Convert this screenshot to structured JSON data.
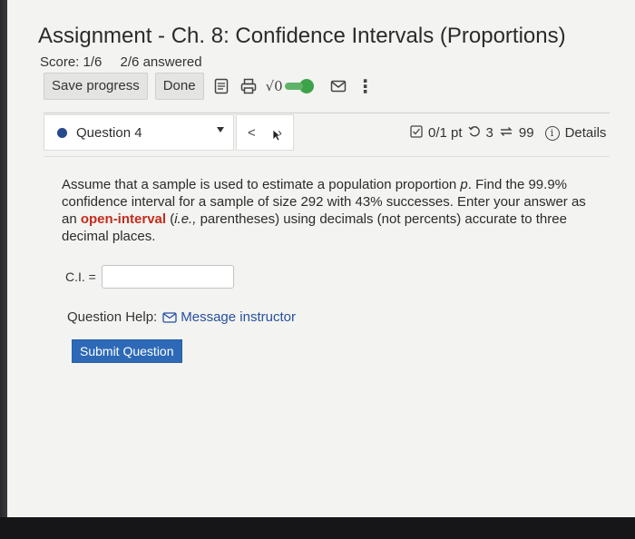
{
  "assignment": {
    "title": "Assignment - Ch. 8: Confidence Intervals (Proportions)",
    "score": "Score: 1/6",
    "answered": "2/6 answered"
  },
  "toolbar": {
    "save_label": "Save progress",
    "done_label": "Done",
    "icons": [
      "document-icon",
      "print-icon",
      "math-toggle-icon",
      "mail-icon",
      "more-icon"
    ],
    "sqrt_glyph": "√0",
    "toggle_color": "#3ca34a",
    "more_glyph": "⋮"
  },
  "question_nav": {
    "current": "Question 4",
    "prev_glyph": "<",
    "next_glyph": "›",
    "dot_color": "#264a8c"
  },
  "meta": {
    "points": "0/1 pt",
    "retries": "3",
    "attempts": "99",
    "details": "Details"
  },
  "question": {
    "text_part1": "Assume that a sample is used to estimate a population proportion ",
    "var_p": "p",
    "text_part2": ". Find the 99.9% confidence interval for a sample of size 292 with 43% successes. Enter your answer as an ",
    "highlight": "open-interval",
    "text_part3": " (",
    "ie": "i.e.,",
    "text_part4": " parentheses) using decimals (not percents) accurate to three decimal places.",
    "highlight_color": "#c32c1d"
  },
  "answer": {
    "label": "C.I. =",
    "value": ""
  },
  "help": {
    "label": "Question Help:",
    "message_link": "Message instructor"
  },
  "submit": {
    "label": "Submit Question",
    "color": "#2d69b6"
  }
}
